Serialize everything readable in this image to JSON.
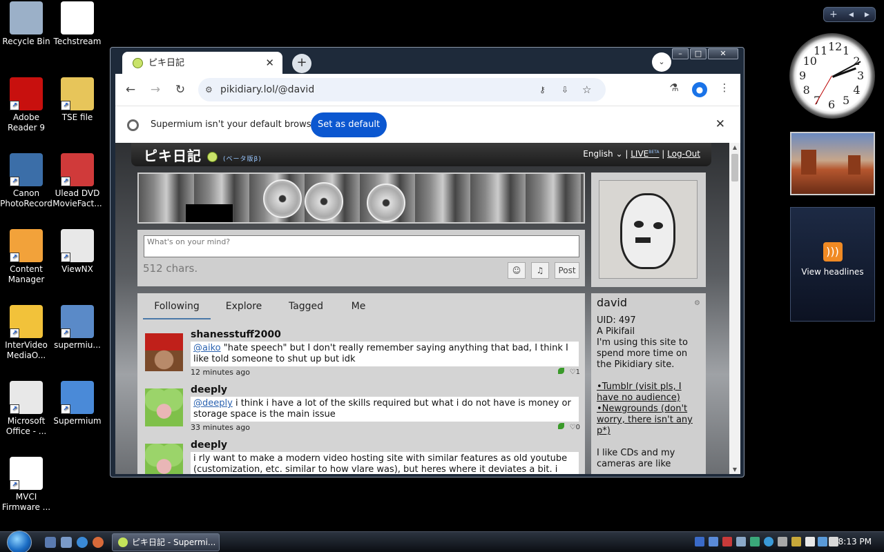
{
  "desktop": {
    "icons": [
      {
        "label": "Recycle Bin",
        "icon": "recycle-bin-icon",
        "color": "#9bb0c8"
      },
      {
        "label": "Techstream",
        "icon": "techstream-icon",
        "color": "#ffffff"
      },
      {
        "label": "Adobe Reader 9",
        "icon": "adobe-reader-icon",
        "color": "#c8100e"
      },
      {
        "label": "TSE file",
        "icon": "folder-icon",
        "color": "#e7c55a"
      },
      {
        "label": "Canon PhotoRecord",
        "icon": "canon-icon",
        "color": "#3b6ea8"
      },
      {
        "label": "Ulead DVD MovieFact...",
        "icon": "ulead-icon",
        "color": "#d03a3a"
      },
      {
        "label": "Content Manager",
        "icon": "content-manager-icon",
        "color": "#f2a23a"
      },
      {
        "label": "ViewNX",
        "icon": "viewnx-icon",
        "color": "#e8e8e8"
      },
      {
        "label": "InterVideo MediaO...",
        "icon": "intervideo-icon",
        "color": "#f2c23a"
      },
      {
        "label": "supermiu...",
        "icon": "installer-icon",
        "color": "#5a8ac8"
      },
      {
        "label": "Microsoft Office - ...",
        "icon": "office-icon",
        "color": "#e8e8e8"
      },
      {
        "label": "Supermium",
        "icon": "supermium-icon",
        "color": "#4a8ad8"
      },
      {
        "label": "MVCI Firmware ...",
        "icon": "mvci-icon",
        "color": "#ffffff"
      }
    ]
  },
  "gadgets": {
    "bar_add": "+",
    "bar_prev": "◂",
    "bar_next": "▸",
    "clock_numbers": [
      "12",
      "1",
      "2",
      "3",
      "4",
      "5",
      "6",
      "7",
      "8",
      "9",
      "10",
      "11"
    ],
    "feed_label": "View headlines"
  },
  "taskbar": {
    "task_label": "ピキ日記 - Supermi...",
    "time": "8:13 PM"
  },
  "browser": {
    "tab_title": "ピキ日記",
    "tab_close": "✕",
    "new_tab": "+",
    "tab_search": "⌄",
    "win_min": "–",
    "win_max": "□",
    "win_close": "✕",
    "back": "←",
    "forward": "→",
    "reload": "↻",
    "url": "pikidiary.lol/@david",
    "info_message": "Supermium isn't your default browser",
    "set_default": "Set as default",
    "info_close": "✕"
  },
  "site": {
    "logo": "ピキ日記",
    "logo_beta": "(ベータ版β)",
    "language": "English",
    "live": "LIVE",
    "live_sup": "BETA",
    "logout": "Log-Out",
    "composer_placeholder": "What's on your mind?",
    "chars_left": "512 chars.",
    "post_button": "Post",
    "feed_tabs": [
      "Following",
      "Explore",
      "Tagged",
      "Me"
    ],
    "posts": [
      {
        "user": "shanesstuff2000",
        "mention": "@aiko",
        "text": " \"hate speech\" but I don't really remember saying anything that bad, I think I like told someone to shut up but idk",
        "time": "12 minutes ago",
        "likes": "1"
      },
      {
        "user": "deeply",
        "mention": "@deeply",
        "text": " i think i have a lot of the skills required but what i do not have is money or storage space is the main issue",
        "time": "33 minutes ago",
        "likes": "0"
      },
      {
        "user": "deeply",
        "mention": "",
        "text": "i rly want to make a modern video hosting site with similar features as old youtube (customization, etc. similar to how vlare was), but heres where it deviates a bit. i",
        "time": "",
        "likes": ""
      }
    ],
    "profile": {
      "name": "david",
      "uid": "UID: 497",
      "title": "A Pikifail",
      "bio": "I'm using this site to spend more time on the Pikidiary site.",
      "link1": "•Tumblr (visit pls, I have no audience)",
      "link2": "•Newgrounds (don't worry, there isn't any p*)",
      "bio2": "I like CDs and my cameras are like"
    }
  }
}
